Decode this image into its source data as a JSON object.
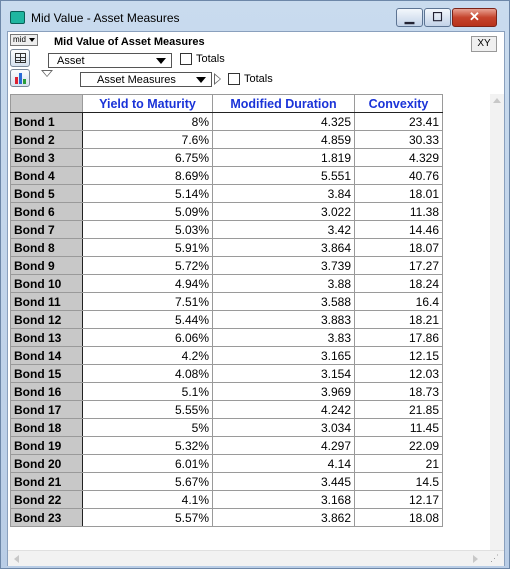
{
  "window": {
    "title": "Mid Value - Asset Measures",
    "minimize_glyph": "▁",
    "maximize_glyph": "☐",
    "close_glyph": "✕"
  },
  "toolbar": {
    "mid_badge": "mid",
    "table_title": "Mid Value of Asset Measures",
    "xy_button": "XY",
    "row_index_dropdown": "Asset",
    "col_index_dropdown": "Asset Measures",
    "totals_label_1": "Totals",
    "totals_label_2": "Totals"
  },
  "icons": {
    "table_view": "table-icon",
    "graph_view": "graph-icon",
    "close": "close-icon"
  },
  "colors": {
    "header_text": "#1a33d8",
    "row_header_bg": "#c8c8c8",
    "close_button": "#c5432c",
    "app_icon": "#1fb6a0"
  },
  "table": {
    "columns": [
      "Yield to Maturity",
      "Modified Duration",
      "Convexity"
    ],
    "rows": [
      {
        "label": "Bond 1",
        "values": [
          "8%",
          "4.325",
          "23.41"
        ]
      },
      {
        "label": "Bond 2",
        "values": [
          "7.6%",
          "4.859",
          "30.33"
        ]
      },
      {
        "label": "Bond 3",
        "values": [
          "6.75%",
          "1.819",
          "4.329"
        ]
      },
      {
        "label": "Bond 4",
        "values": [
          "8.69%",
          "5.551",
          "40.76"
        ]
      },
      {
        "label": "Bond 5",
        "values": [
          "5.14%",
          "3.84",
          "18.01"
        ]
      },
      {
        "label": "Bond 6",
        "values": [
          "5.09%",
          "3.022",
          "11.38"
        ]
      },
      {
        "label": "Bond 7",
        "values": [
          "5.03%",
          "3.42",
          "14.46"
        ]
      },
      {
        "label": "Bond 8",
        "values": [
          "5.91%",
          "3.864",
          "18.07"
        ]
      },
      {
        "label": "Bond 9",
        "values": [
          "5.72%",
          "3.739",
          "17.27"
        ]
      },
      {
        "label": "Bond 10",
        "values": [
          "4.94%",
          "3.88",
          "18.24"
        ]
      },
      {
        "label": "Bond 11",
        "values": [
          "7.51%",
          "3.588",
          "16.4"
        ]
      },
      {
        "label": "Bond 12",
        "values": [
          "5.44%",
          "3.883",
          "18.21"
        ]
      },
      {
        "label": "Bond 13",
        "values": [
          "6.06%",
          "3.83",
          "17.86"
        ]
      },
      {
        "label": "Bond 14",
        "values": [
          "4.2%",
          "3.165",
          "12.15"
        ]
      },
      {
        "label": "Bond 15",
        "values": [
          "4.08%",
          "3.154",
          "12.03"
        ]
      },
      {
        "label": "Bond 16",
        "values": [
          "5.1%",
          "3.969",
          "18.73"
        ]
      },
      {
        "label": "Bond 17",
        "values": [
          "5.55%",
          "4.242",
          "21.85"
        ]
      },
      {
        "label": "Bond 18",
        "values": [
          "5%",
          "3.034",
          "11.45"
        ]
      },
      {
        "label": "Bond 19",
        "values": [
          "5.32%",
          "4.297",
          "22.09"
        ]
      },
      {
        "label": "Bond 20",
        "values": [
          "6.01%",
          "4.14",
          "21"
        ]
      },
      {
        "label": "Bond 21",
        "values": [
          "5.67%",
          "3.445",
          "14.5"
        ]
      },
      {
        "label": "Bond 22",
        "values": [
          "4.1%",
          "3.168",
          "12.17"
        ]
      },
      {
        "label": "Bond 23",
        "values": [
          "5.57%",
          "3.862",
          "18.08"
        ]
      }
    ]
  }
}
